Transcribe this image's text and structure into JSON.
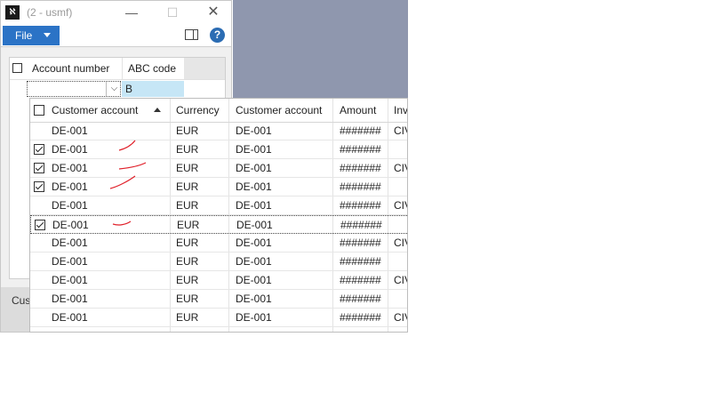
{
  "window": {
    "title": "(2 - usmf)",
    "app_icon": "app-icon",
    "minimize_glyph": "—",
    "maximize_glyph": "☐",
    "close_glyph": "✕"
  },
  "ribbon": {
    "file_label": "File",
    "help_glyph": "?"
  },
  "parent_grid": {
    "col_account": "Account number",
    "col_abc": "ABC code",
    "abc_value": "B"
  },
  "status": {
    "text": "Cus"
  },
  "lookup": {
    "headers": {
      "customer_account": "Customer account",
      "currency": "Currency",
      "customer_account_2": "Customer account",
      "amount": "Amount",
      "invoice": "Inv"
    },
    "rows": [
      {
        "checked": false,
        "account": "DE-001",
        "currency": "EUR",
        "cust": "DE-001",
        "amount": "#######",
        "inv": "CIV",
        "mark": false
      },
      {
        "checked": true,
        "account": "DE-001",
        "currency": "EUR",
        "cust": "DE-001",
        "amount": "#######",
        "inv": "",
        "mark": true
      },
      {
        "checked": true,
        "account": "DE-001",
        "currency": "EUR",
        "cust": "DE-001",
        "amount": "#######",
        "inv": "CIV",
        "mark": true
      },
      {
        "checked": true,
        "account": "DE-001",
        "currency": "EUR",
        "cust": "DE-001",
        "amount": "#######",
        "inv": "",
        "mark": true
      },
      {
        "checked": false,
        "account": "DE-001",
        "currency": "EUR",
        "cust": "DE-001",
        "amount": "#######",
        "inv": "CIV",
        "mark": false
      },
      {
        "checked": true,
        "account": "DE-001",
        "currency": "EUR",
        "cust": "DE-001",
        "amount": "#######",
        "inv": "",
        "mark": true
      },
      {
        "checked": false,
        "account": "DE-001",
        "currency": "EUR",
        "cust": "DE-001",
        "amount": "#######",
        "inv": "CIV",
        "mark": false
      },
      {
        "checked": false,
        "account": "DE-001",
        "currency": "EUR",
        "cust": "DE-001",
        "amount": "#######",
        "inv": "",
        "mark": false
      },
      {
        "checked": false,
        "account": "DE-001",
        "currency": "EUR",
        "cust": "DE-001",
        "amount": "#######",
        "inv": "CIV",
        "mark": false
      },
      {
        "checked": false,
        "account": "DE-001",
        "currency": "EUR",
        "cust": "DE-001",
        "amount": "#######",
        "inv": "",
        "mark": false
      },
      {
        "checked": false,
        "account": "DE-001",
        "currency": "EUR",
        "cust": "DE-001",
        "amount": "#######",
        "inv": "CIV",
        "mark": false
      }
    ],
    "selected_row": 5
  },
  "colors": {
    "accent": "#2b73c6",
    "highlight": "#c6e6f6",
    "desktop": "#8f97ae",
    "annotation": "#e0202a"
  }
}
